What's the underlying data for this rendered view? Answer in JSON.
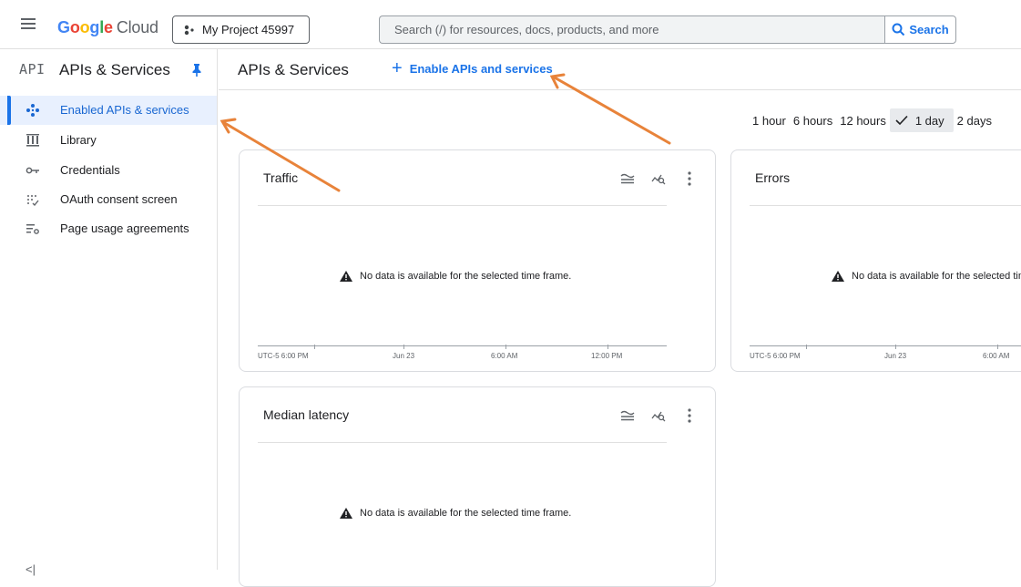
{
  "topbar": {
    "brand": "Google",
    "brand_product": "Cloud",
    "project": "My Project 45997",
    "search_placeholder": "Search (/) for resources, docs, products, and more",
    "search_button": "Search"
  },
  "sidebar": {
    "logo": "API",
    "title": "APIs & Services",
    "items": [
      {
        "label": "Enabled APIs & services",
        "icon": "diamond-icon",
        "active": true
      },
      {
        "label": "Library",
        "icon": "library-icon"
      },
      {
        "label": "Credentials",
        "icon": "key-icon"
      },
      {
        "label": "OAuth consent screen",
        "icon": "consent-icon"
      },
      {
        "label": "Page usage agreements",
        "icon": "settings-list-icon"
      }
    ],
    "collapse": "<|"
  },
  "main": {
    "title": "APIs & Services",
    "enable_button": "Enable APIs and services"
  },
  "time_range": {
    "options": [
      "1 hour",
      "6 hours",
      "12 hours",
      "1 day",
      "2 days"
    ],
    "selected": "1 day"
  },
  "cards": {
    "traffic": {
      "title": "Traffic",
      "no_data": "No data is available for the selected time frame.",
      "ticks": [
        "UTC-5  6:00 PM",
        "Jun 23",
        "6:00 AM",
        "12:00 PM"
      ]
    },
    "errors": {
      "title": "Errors",
      "no_data": "No data is available for the selected time frame.",
      "ticks": [
        "UTC-5  6:00 PM",
        "Jun 23",
        "6:00 AM"
      ]
    },
    "latency": {
      "title": "Median latency",
      "no_data": "No data is available for the selected time frame."
    }
  },
  "colors": {
    "accent": "#1a73e8",
    "active_bg": "#e8f0fe",
    "annotation_arrow": "#e8833a"
  }
}
